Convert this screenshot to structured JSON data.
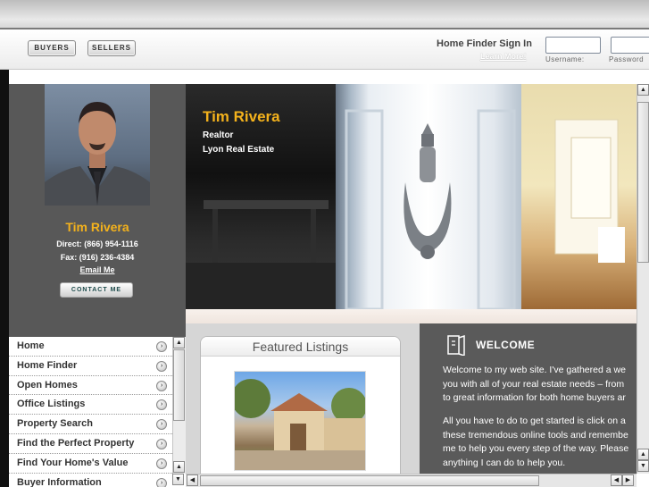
{
  "header": {
    "buyers_label": "BUYERS",
    "sellers_label": "SELLERS",
    "signin_label": "Home Finder Sign In",
    "learn_more": "Learn More!",
    "username_label": "Username:",
    "password_label": "Password"
  },
  "agent": {
    "name": "Tim Rivera",
    "direct": "Direct: (866) 954-1116",
    "fax": "Fax: (916) 236-4384",
    "email_link": "Email Me",
    "contact_button": "CONTACT ME"
  },
  "hero": {
    "name": "Tim Rivera",
    "title": "Realtor",
    "company": "Lyon Real Estate"
  },
  "nav": {
    "items": [
      "Home",
      "Home Finder",
      "Open Homes",
      "Office Listings",
      "Property Search",
      "Find the Perfect Property",
      "Find Your Home's Value",
      "Buyer Information"
    ]
  },
  "featured": {
    "title": "Featured Listings"
  },
  "welcome": {
    "title": "WELCOME",
    "para1_line1": "Welcome to my web site. I've gathered a we",
    "para1_line2": "you with all of your real estate needs – from",
    "para1_line3": "to great information for both home buyers ar",
    "para2_line1": "All you have to do to get started is click on a",
    "para2_line2": "these tremendous online tools and remembe",
    "para2_line3": "me to help you every step of the way. Please",
    "para2_line4": "anything I can do to help you."
  },
  "icons": {
    "nav_arrow": "chevron-right-icon",
    "welcome": "door-icon",
    "scroll_up": "arrow-up-icon",
    "scroll_down": "arrow-down-icon",
    "scroll_left": "arrow-left-icon",
    "scroll_right": "arrow-right-icon"
  },
  "colors": {
    "accent_gold": "#f4b21c",
    "panel_gray": "#585858",
    "welcome_gray": "#5a5a5a"
  }
}
